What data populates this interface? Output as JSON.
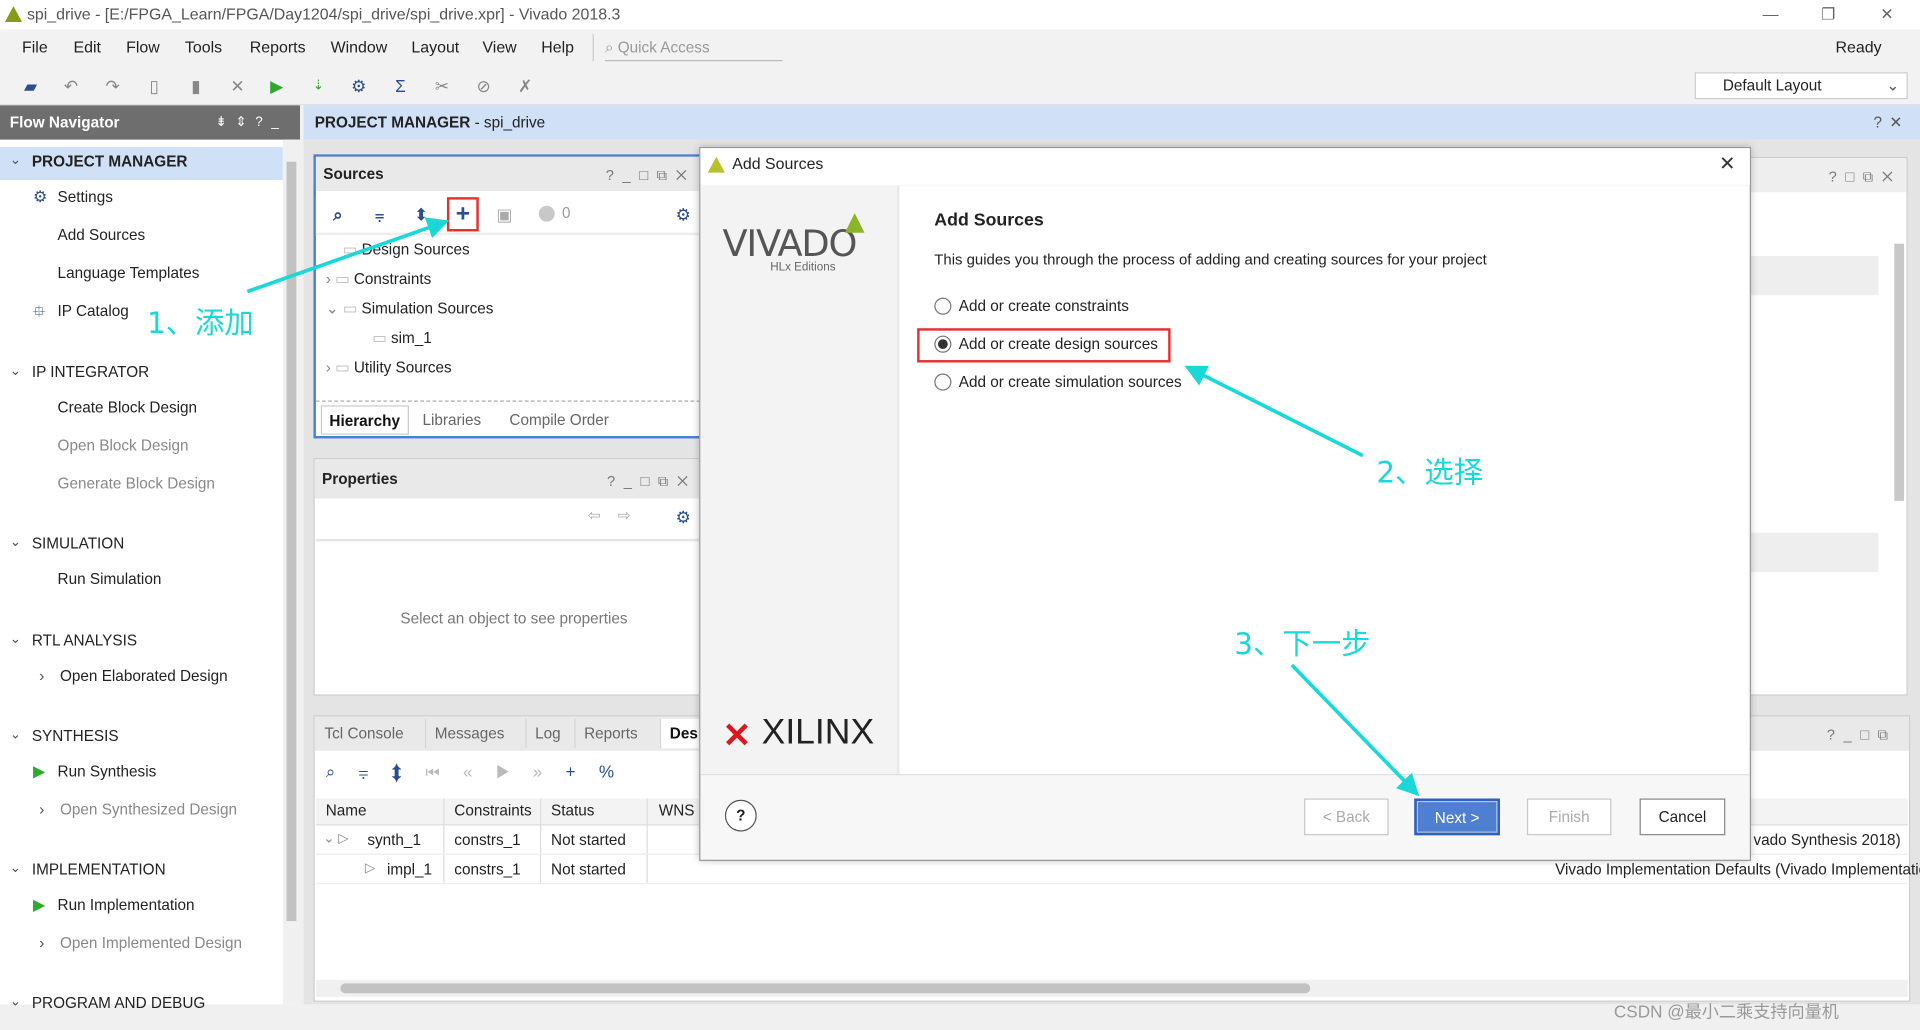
{
  "window": {
    "title": "spi_drive - [E:/FPGA_Learn/FPGA/Day1204/spi_drive/spi_drive.xpr] - Vivado 2018.3",
    "minimize": "—",
    "restore": "❐",
    "close": "✕"
  },
  "menu": {
    "items": [
      "File",
      "Edit",
      "Flow",
      "Tools",
      "Reports",
      "Window",
      "Layout",
      "View",
      "Help"
    ],
    "quick_access_placeholder": "Quick Access",
    "status": "Ready",
    "layout_select": "Default Layout"
  },
  "toolbar": {
    "icons": [
      "open-project-icon",
      "undo-icon",
      "redo-icon",
      "copy-icon",
      "paste-icon",
      "delete-icon",
      "run-icon",
      "program-icon",
      "settings-icon",
      "sigma-icon",
      "cut-icon",
      "link-icon",
      "x-icon"
    ]
  },
  "flow_navigator": {
    "title": "Flow Navigator",
    "sections": [
      {
        "label": "PROJECT MANAGER",
        "items": [
          {
            "label": "Settings",
            "icon": "gear"
          },
          {
            "label": "Add Sources"
          },
          {
            "label": "Language Templates"
          },
          {
            "label": "IP Catalog",
            "icon": "ip"
          }
        ]
      },
      {
        "label": "IP INTEGRATOR",
        "items": [
          {
            "label": "Create Block Design"
          },
          {
            "label": "Open Block Design",
            "disabled": true
          },
          {
            "label": "Generate Block Design",
            "disabled": true
          }
        ]
      },
      {
        "label": "SIMULATION",
        "items": [
          {
            "label": "Run Simulation"
          }
        ]
      },
      {
        "label": "RTL ANALYSIS",
        "items": [
          {
            "label": "Open Elaborated Design"
          }
        ]
      },
      {
        "label": "SYNTHESIS",
        "items": [
          {
            "label": "Run Synthesis"
          },
          {
            "label": "Open Synthesized Design",
            "disabled": true
          }
        ]
      },
      {
        "label": "IMPLEMENTATION",
        "items": [
          {
            "label": "Run Implementation"
          },
          {
            "label": "Open Implemented Design",
            "disabled": true
          }
        ]
      },
      {
        "label": "PROGRAM AND DEBUG",
        "items": []
      }
    ]
  },
  "main": {
    "header_bold": "PROJECT MANAGER",
    "header_rest": " - spi_drive"
  },
  "sources": {
    "title": "Sources",
    "warning_count": "0",
    "tree": [
      "Design Sources",
      "Constraints",
      "Simulation Sources",
      "sim_1",
      "Utility Sources"
    ],
    "tabs": [
      "Hierarchy",
      "Libraries",
      "Compile Order"
    ]
  },
  "properties": {
    "title": "Properties",
    "empty": "Select an object to see properties"
  },
  "bottom": {
    "tabs": [
      "Tcl Console",
      "Messages",
      "Log",
      "Reports",
      "Des"
    ],
    "columns": [
      "Name",
      "Constraints",
      "Status",
      "WNS"
    ],
    "rows": [
      [
        "synth_1",
        "constrs_1",
        "Not started",
        ""
      ],
      [
        "impl_1",
        "constrs_1",
        "Not started",
        ""
      ]
    ],
    "right_cells": [
      "vado Synthesis 2018)",
      "Vivado Implementation Defaults (Vivado Implementatic"
    ]
  },
  "dialog": {
    "title": "Add Sources",
    "logo_vivado": "VIVADO",
    "logo_sub": "HLx Editions",
    "logo_xilinx": "XILINX",
    "heading": "Add Sources",
    "description": "This guides you through the process of adding and creating sources for your project",
    "options": [
      "Add or create constraints",
      "Add or create design sources",
      "Add or create simulation sources"
    ],
    "selected": 1,
    "help": "?",
    "back": "< Back",
    "next": "Next >",
    "finish": "Finish",
    "cancel": "Cancel"
  },
  "annotations": {
    "step1": "1、添加",
    "step2": "2、选择",
    "step3": "3、下一步",
    "color": "#1ad8d8",
    "box_color": "#e53030"
  },
  "watermark": "CSDN @最小二乘支持向量机"
}
